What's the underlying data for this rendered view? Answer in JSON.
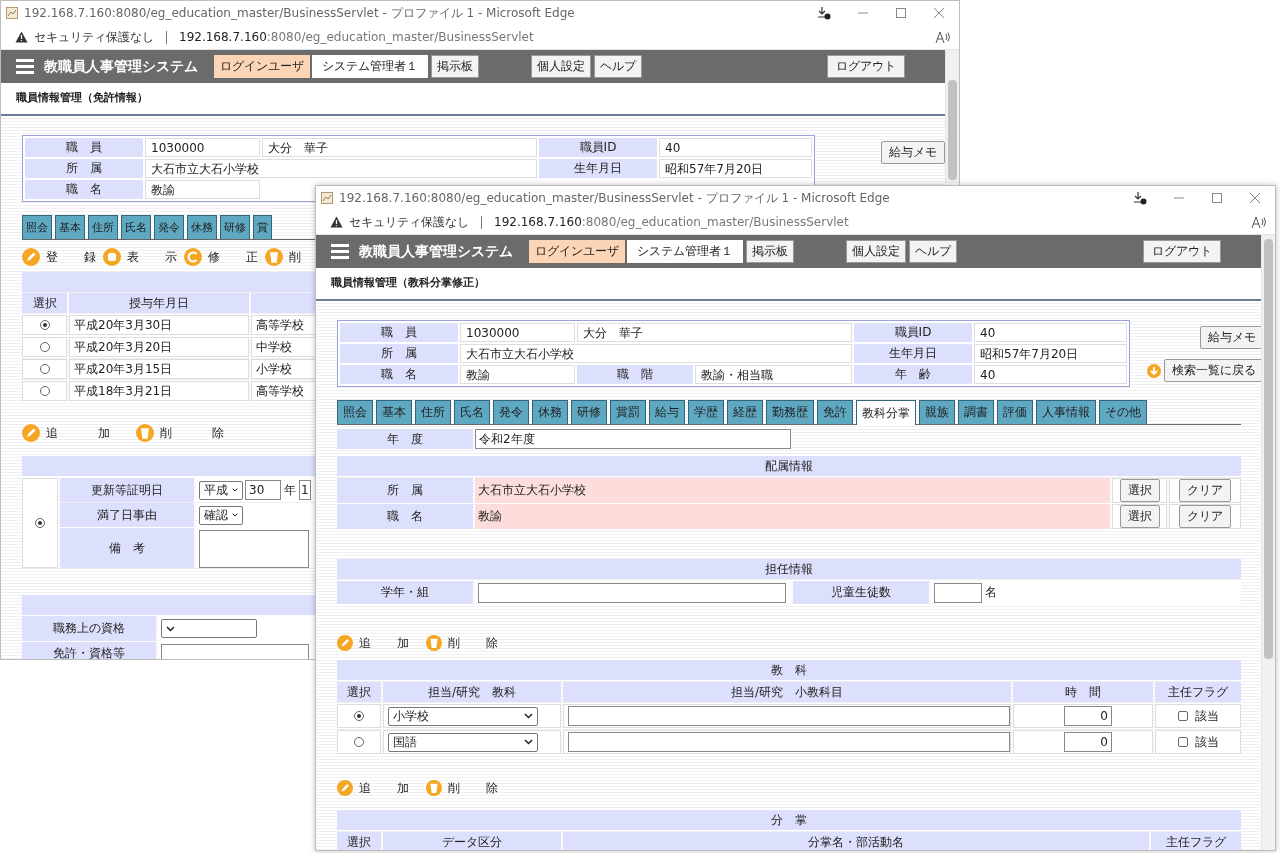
{
  "windows": [
    {
      "kind": "license",
      "title": "192.168.7.160:8080/eg_education_master/BusinessServlet - プロファイル 1 - Microsoft Edge",
      "address": {
        "security": "セキュリティ保護なし",
        "host": "192.168.7.160",
        "path": ":8080/eg_education_master/BusinessServlet"
      },
      "app": {
        "title": "教職員人事管理システム",
        "login_label": "ログインユーザ",
        "user": "システム管理者１",
        "board": "掲示板",
        "settings": "個人設定",
        "help": "ヘルプ",
        "logout": "ログアウト"
      },
      "page_title": "職員情報管理（免許情報）",
      "staff_info": {
        "rows": [
          {
            "cells": [
              {
                "kind": "label",
                "text": "職　員"
              },
              {
                "kind": "value",
                "text": "1030000"
              },
              {
                "kind": "value_wide",
                "text": "大分　華子"
              }
            ],
            "side": [
              {
                "kind": "label",
                "text": "職員ID"
              },
              {
                "kind": "value",
                "text": "40"
              }
            ]
          },
          {
            "cells": [
              {
                "kind": "label",
                "text": "所　属"
              },
              {
                "kind": "value_long",
                "text": "大石市立大石小学校"
              }
            ],
            "side": [
              {
                "kind": "label",
                "text": "生年月日"
              },
              {
                "kind": "value",
                "text": "昭和57年7月20日"
              }
            ]
          },
          {
            "cells": [
              {
                "kind": "label",
                "text": "職　名"
              },
              {
                "kind": "value",
                "text": "教諭"
              }
            ]
          }
        ],
        "memo_button": "給与メモ"
      },
      "tabs": [
        {
          "label": "照会",
          "selected": false
        },
        {
          "label": "基本",
          "selected": false
        },
        {
          "label": "住所",
          "selected": false
        },
        {
          "label": "氏名",
          "selected": false
        },
        {
          "label": "発令",
          "selected": false
        },
        {
          "label": "休務",
          "selected": false
        },
        {
          "label": "研修",
          "selected": false
        },
        {
          "label": "賞",
          "selected": false
        }
      ],
      "toolbar": [
        {
          "kind": "register",
          "label": "登　録"
        },
        {
          "kind": "view",
          "label": "表　示"
        },
        {
          "kind": "edit",
          "label": "修　正"
        },
        {
          "kind": "delete",
          "label": "削"
        }
      ],
      "licenses": {
        "columns": [
          "選択",
          "授与年月日"
        ],
        "rows": [
          {
            "selected": true,
            "date": "平成20年3月30日",
            "school": "高等学校"
          },
          {
            "selected": false,
            "date": "平成20年3月20日",
            "school": "中学校"
          },
          {
            "selected": false,
            "date": "平成20年3月15日",
            "school": "小学校"
          },
          {
            "selected": false,
            "date": "平成18年3月21日",
            "school": "高等学校"
          }
        ]
      },
      "renewal_toolbar": [
        {
          "kind": "add",
          "label": "追　加"
        },
        {
          "kind": "delete",
          "label": "削　除"
        }
      ],
      "renewal": {
        "selected": true,
        "fields": [
          {
            "kind": "date",
            "label": "更新等証明日",
            "era": "平成",
            "year": "30",
            "year_unit": "年",
            "month": "1"
          },
          {
            "kind": "select",
            "label": "満了日事由",
            "value": "確認"
          },
          {
            "kind": "textarea",
            "label": "備　考"
          }
        ]
      },
      "qualifications": {
        "fields": [
          {
            "kind": "select",
            "label": "職務上の資格"
          },
          {
            "kind": "textarea",
            "label": "免許・資格等"
          }
        ]
      }
    },
    {
      "kind": "subject",
      "title": "192.168.7.160:8080/eg_education_master/BusinessServlet - プロファイル 1 - Microsoft Edge",
      "address": {
        "security": "セキュリティ保護なし",
        "host": "192.168.7.160",
        "path": ":8080/eg_education_master/BusinessServlet"
      },
      "app": {
        "title": "教職員人事管理システム",
        "login_label": "ログインユーザ",
        "user": "システム管理者１",
        "board": "掲示板",
        "settings": "個人設定",
        "help": "ヘルプ",
        "logout": "ログアウト"
      },
      "page_title": "職員情報管理（教科分掌修正）",
      "staff_info": {
        "rows": [
          {
            "cells": [
              {
                "kind": "label",
                "text": "職　員"
              },
              {
                "kind": "value",
                "text": "1030000"
              },
              {
                "kind": "value_wide",
                "text": "大分　華子"
              }
            ],
            "side": [
              {
                "kind": "label",
                "text": "職員ID"
              },
              {
                "kind": "value",
                "text": "40"
              }
            ]
          },
          {
            "cells": [
              {
                "kind": "label",
                "text": "所　属"
              },
              {
                "kind": "value_long",
                "text": "大石市立大石小学校"
              }
            ],
            "side": [
              {
                "kind": "label",
                "text": "生年月日"
              },
              {
                "kind": "value",
                "text": "昭和57年7月20日"
              }
            ]
          },
          {
            "cells": [
              {
                "kind": "label",
                "text": "職　名"
              },
              {
                "kind": "value",
                "text": "教諭"
              },
              {
                "kind": "label",
                "text": "職　階"
              },
              {
                "kind": "value",
                "text": "教諭・相当職"
              }
            ],
            "side": [
              {
                "kind": "label",
                "text": "年　齢"
              },
              {
                "kind": "value",
                "text": "40"
              }
            ]
          }
        ],
        "memo_button": "給与メモ",
        "back_button": "検索一覧に戻る"
      },
      "tabs": [
        {
          "label": "照会",
          "selected": false
        },
        {
          "label": "基本",
          "selected": false
        },
        {
          "label": "住所",
          "selected": false
        },
        {
          "label": "氏名",
          "selected": false
        },
        {
          "label": "発令",
          "selected": false
        },
        {
          "label": "休務",
          "selected": false
        },
        {
          "label": "研修",
          "selected": false
        },
        {
          "label": "賞罰",
          "selected": false
        },
        {
          "label": "給与",
          "selected": false
        },
        {
          "label": "学歴",
          "selected": false
        },
        {
          "label": "経歴",
          "selected": false
        },
        {
          "label": "勤務歴",
          "selected": false
        },
        {
          "label": "免許",
          "selected": false
        },
        {
          "label": "教科分掌",
          "selected": true
        },
        {
          "label": "親族",
          "selected": false
        },
        {
          "label": "調書",
          "selected": false
        },
        {
          "label": "評価",
          "selected": false
        },
        {
          "label": "人事情報",
          "selected": false
        },
        {
          "label": "その他",
          "selected": false
        }
      ],
      "year": {
        "label": "年　度",
        "value": "令和2年度"
      },
      "assignment": {
        "title": "配属情報",
        "rows": [
          {
            "label": "所　属",
            "value": "大石市立大石小学校",
            "select_button": "選択",
            "clear_button": "クリア"
          },
          {
            "label": "職　名",
            "value": "教諭",
            "select_button": "選択",
            "clear_button": "クリア"
          }
        ]
      },
      "homeroom": {
        "title": "担任情報",
        "class_label": "学年・組",
        "count_label": "児童生徒数",
        "count_unit": "名"
      },
      "subject_toolbar": [
        {
          "kind": "add",
          "label": "追　加"
        },
        {
          "kind": "delete",
          "label": "削　除"
        }
      ],
      "subjects": {
        "title": "教　科",
        "columns": [
          "選択",
          "担当/研究　教科",
          "担当/研究　小教科目",
          "時　間",
          "主任フラグ"
        ],
        "rows": [
          {
            "selected": true,
            "subject": "小学校",
            "hours": "0",
            "flag": "該当",
            "checked": false
          },
          {
            "selected": false,
            "subject": "国語",
            "hours": "0",
            "flag": "該当",
            "checked": false
          }
        ]
      },
      "duty_toolbar": [
        {
          "kind": "add",
          "label": "追　加"
        },
        {
          "kind": "delete",
          "label": "削　除"
        }
      ],
      "duties": {
        "title": "分　掌",
        "columns": [
          "選択",
          "データ区分",
          "分掌名・部活動名",
          "主任フラグ"
        ]
      }
    }
  ]
}
